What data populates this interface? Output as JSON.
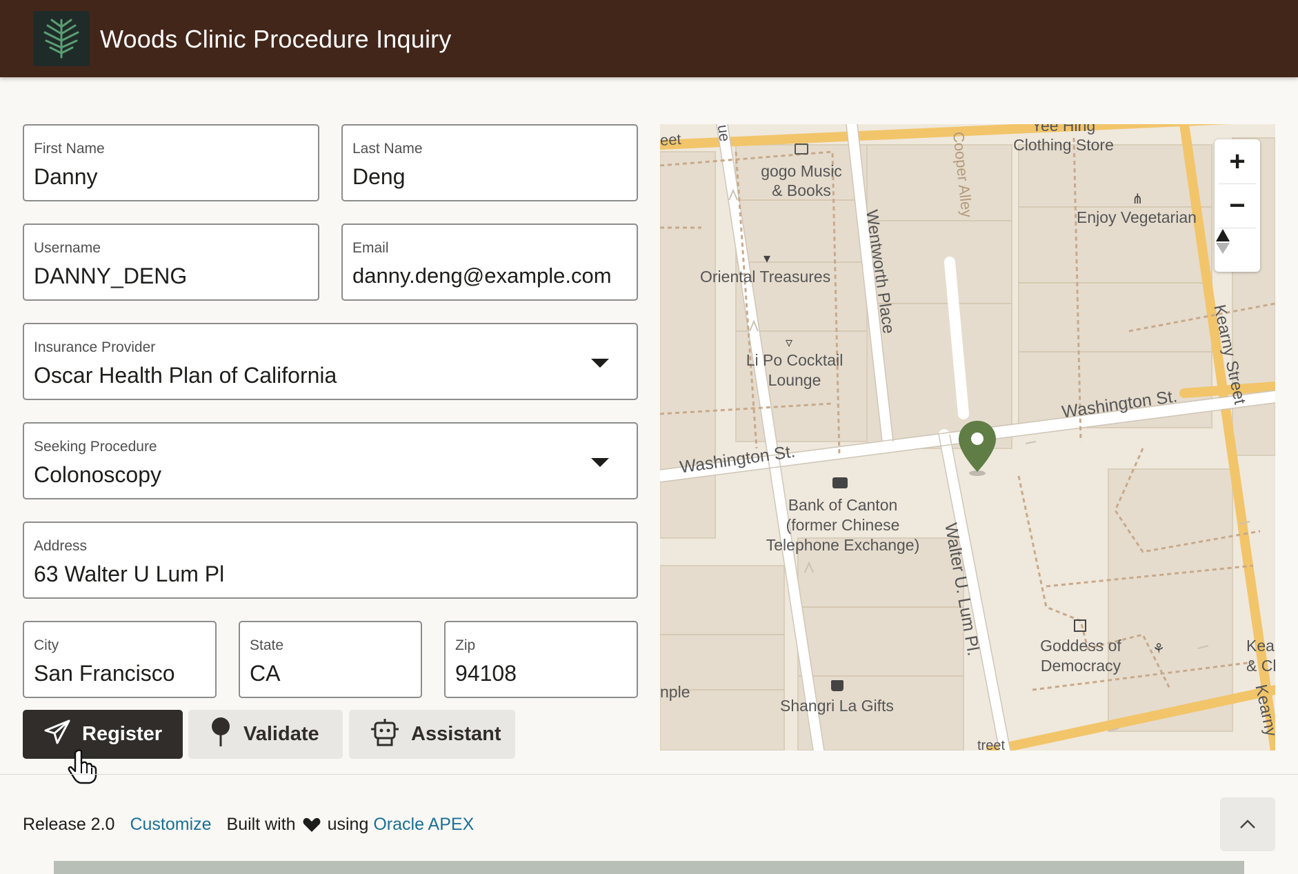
{
  "header": {
    "title": "Woods Clinic Procedure Inquiry",
    "logo_icon": "tree-icon"
  },
  "form": {
    "first_name": {
      "label": "First Name",
      "value": "Danny"
    },
    "last_name": {
      "label": "Last Name",
      "value": "Deng"
    },
    "username": {
      "label": "Username",
      "value": "DANNY_DENG"
    },
    "email": {
      "label": "Email",
      "value": "danny.deng@example.com"
    },
    "insurance": {
      "label": "Insurance Provider",
      "value": "Oscar Health Plan of California"
    },
    "procedure": {
      "label": "Seeking Procedure",
      "value": "Colonoscopy"
    },
    "address": {
      "label": "Address",
      "value": "63 Walter U Lum Pl"
    },
    "city": {
      "label": "City",
      "value": "San Francisco"
    },
    "state": {
      "label": "State",
      "value": "CA"
    },
    "zip": {
      "label": "Zip",
      "value": "94108"
    }
  },
  "buttons": {
    "register": "Register",
    "validate": "Validate",
    "assistant": "Assistant"
  },
  "map": {
    "streets": {
      "washington_east": "Washington St.",
      "washington_west": "Washington St.",
      "wentworth": "Wentworth Place",
      "cooper": "Cooper Alley",
      "kearny": "Kearny Street",
      "kearny_bottom": "Kearny",
      "walter": "Walter U. Lum Pl.",
      "eet": "eet",
      "ue": "ue",
      "nple": "nple",
      "treet": "treet"
    },
    "pois": {
      "yee_hing_1": "Yee Hing",
      "yee_hing_2": "Clothing Store",
      "gogo_1": "gogo Music",
      "gogo_2": "& Books",
      "enjoy": "Enjoy Vegetarian",
      "oriental": "Oriental Treasures",
      "lipo_1": "Li Po Cocktail",
      "lipo_2": "Lounge",
      "bank_1": "Bank of Canton",
      "bank_2": "(former Chinese",
      "bank_3": "Telephone Exchange)",
      "goddess_1": "Goddess of",
      "goddess_2": "Democracy",
      "kearn_1": "Kearn",
      "kearn_2": "& Cla",
      "shangri": "Shangri La Gifts"
    },
    "controls": {
      "zoom_in": "+",
      "zoom_out": "−"
    },
    "marker_color": "#5f7d45"
  },
  "footer": {
    "release": "Release 2.0",
    "customize": "Customize",
    "built_with": "Built with",
    "using": "using",
    "oracle": "Oracle APEX"
  },
  "colors": {
    "header_bg": "#43261a",
    "primary_button": "#312d2a",
    "link": "#1a6f96"
  }
}
